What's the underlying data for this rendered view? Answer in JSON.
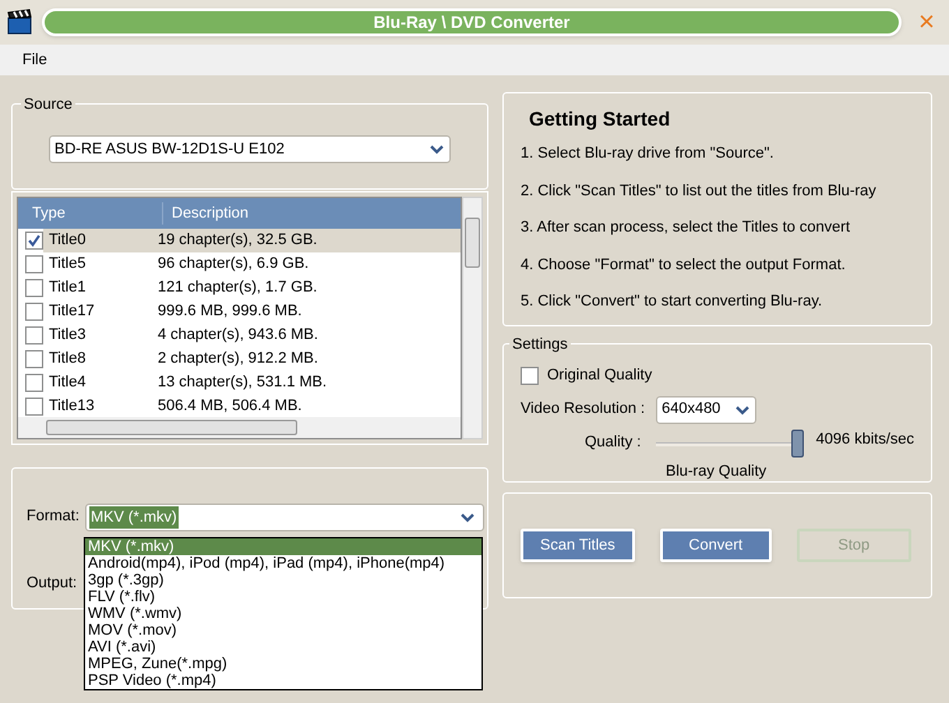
{
  "window": {
    "title": "Blu-Ray \\ DVD Converter",
    "close": "×"
  },
  "menu": [
    "File"
  ],
  "source": {
    "label": "Source",
    "value": "BD-RE ASUS BW-12D1S-U E102"
  },
  "titles": {
    "columns": [
      "Type",
      "Description"
    ],
    "rows": [
      {
        "type": "Title0",
        "description": "19 chapter(s), 32.5 GB.",
        "checked": true,
        "selected": true
      },
      {
        "type": "Title5",
        "description": "96 chapter(s), 6.9 GB.",
        "checked": false,
        "selected": false
      },
      {
        "type": "Title1",
        "description": "121 chapter(s), 1.7 GB.",
        "checked": false,
        "selected": false
      },
      {
        "type": "Title17",
        "description": "999.6 MB, 999.6 MB.",
        "checked": false,
        "selected": false
      },
      {
        "type": "Title3",
        "description": "4 chapter(s), 943.6 MB.",
        "checked": false,
        "selected": false
      },
      {
        "type": "Title8",
        "description": "2 chapter(s), 912.2 MB.",
        "checked": false,
        "selected": false
      },
      {
        "type": "Title4",
        "description": "13 chapter(s), 531.1 MB.",
        "checked": false,
        "selected": false
      },
      {
        "type": "Title13",
        "description": "506.4 MB, 506.4 MB.",
        "checked": false,
        "selected": false
      }
    ]
  },
  "format": {
    "label": "Format:",
    "value": "MKV (*.mkv)",
    "output_label": "Output:",
    "options": [
      {
        "label": "MKV (*.mkv)",
        "selected": true
      },
      {
        "label": "Android(mp4), iPod (mp4), iPad (mp4), iPhone(mp4)",
        "selected": false
      },
      {
        "label": "3gp (*.3gp)",
        "selected": false
      },
      {
        "label": "FLV (*.flv)",
        "selected": false
      },
      {
        "label": "WMV (*.wmv)",
        "selected": false
      },
      {
        "label": "MOV (*.mov)",
        "selected": false
      },
      {
        "label": "AVI (*.avi)",
        "selected": false
      },
      {
        "label": "MPEG, Zune(*.mpg)",
        "selected": false
      },
      {
        "label": "PSP Video (*.mp4)",
        "selected": false
      }
    ]
  },
  "getting_started": {
    "title": "Getting Started",
    "steps": [
      "1. Select Blu-ray drive from \"Source\".",
      "2. Click \"Scan Titles\" to list out the titles from Blu-ray",
      "3. After scan process, select the Titles to convert",
      "4. Choose \"Format\" to select the output Format.",
      "5. Click \"Convert\" to start converting Blu-ray."
    ]
  },
  "settings": {
    "label": "Settings",
    "original_quality": {
      "label": "Original Quality",
      "checked": false
    },
    "resolution_label": "Video Resolution :",
    "resolution": "640x480",
    "quality_label": "Quality :",
    "quality": {
      "level": 0.95
    },
    "quality_reading": "4096 kbits/sec",
    "quality_caption": "Blu-ray Quality"
  },
  "buttons": [
    {
      "label": "Scan Titles",
      "disabled": false
    },
    {
      "label": "Convert",
      "disabled": false
    },
    {
      "label": "Stop",
      "disabled": true
    }
  ]
}
